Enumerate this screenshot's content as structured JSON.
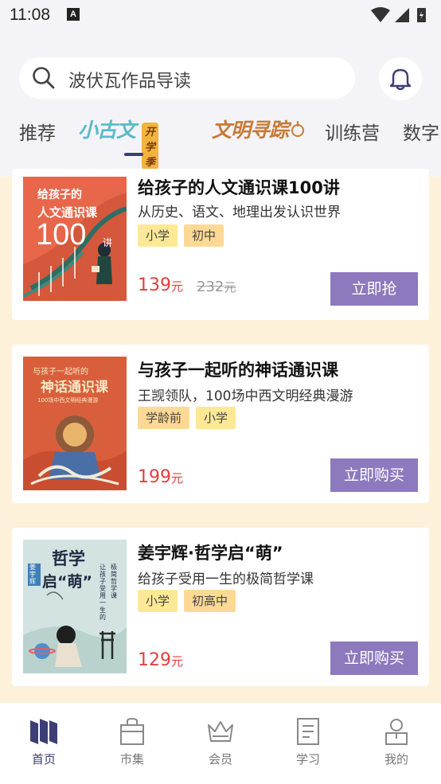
{
  "status_bar": {
    "time": "11:08",
    "notification_letter": "A"
  },
  "search": {
    "placeholder": "波伏瓦作品导读"
  },
  "tabs": [
    {
      "label": "推荐"
    },
    {
      "label": "小古文",
      "badge": "开学季"
    },
    {
      "label": "文明寻踪"
    },
    {
      "label": "训练营"
    },
    {
      "label": "数字"
    }
  ],
  "courses": [
    {
      "title": "给孩子的人文通识课100讲",
      "subtitle": "从历史、语文、地理出发认识世界",
      "tags": [
        "小学",
        "初中"
      ],
      "price": "139",
      "price_unit": "元",
      "original_price": "232",
      "original_unit": "元",
      "button": "立即抢",
      "cover": {
        "line1": "给孩子的",
        "line2": "人文通识课",
        "number": "100",
        "suffix": "讲"
      }
    },
    {
      "title": "与孩子一起听的神话通识课",
      "subtitle": "王觊领队，100场中西文明经典漫游",
      "tags": [
        "学龄前",
        "小学"
      ],
      "price": "199",
      "price_unit": "元",
      "button": "立即购买",
      "cover": {
        "line1": "与孩子一起听的",
        "line2": "神话通识课",
        "line3": "100场中西文明经典漫游"
      }
    },
    {
      "title": "姜宇辉·哲学启“萌”",
      "subtitle": "给孩子受用一生的极简哲学课",
      "tags": [
        "小学",
        "初高中"
      ],
      "price": "129",
      "price_unit": "元",
      "button": "立即购买",
      "cover": {
        "line1": "哲学",
        "line2": "启“萌”",
        "author": "姜宇辉",
        "side1": "让孩子受用一生的",
        "side2": "极简哲学课"
      }
    }
  ],
  "bottom_nav": [
    {
      "label": "首页",
      "icon": "books-icon",
      "active": true
    },
    {
      "label": "市集",
      "icon": "bag-icon"
    },
    {
      "label": "会员",
      "icon": "crown-icon"
    },
    {
      "label": "学习",
      "icon": "notebook-icon"
    },
    {
      "label": "我的",
      "icon": "user-icon"
    }
  ],
  "colors": {
    "accent": "#8d79bd",
    "price": "#e33e3e",
    "background": "#fdf1da",
    "nav_active": "#3c3e75",
    "tag_yellow": "#fde896",
    "tag_orange": "#fdd995"
  }
}
